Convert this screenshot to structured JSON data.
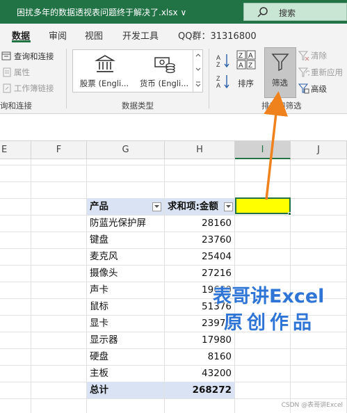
{
  "window": {
    "title": "困扰多年的数据透视表问题终于解决了.xlsx",
    "title_dropdown": "∨",
    "search_label": "搜索"
  },
  "menu": {
    "tabs": [
      "数据",
      "审阅",
      "视图",
      "开发工具",
      "QQ群：31316800"
    ],
    "active_tab": "数据"
  },
  "ribbon": {
    "get_data_group": {
      "items": [
        "查询和连接",
        "属性",
        "工作簿链接"
      ],
      "label": "询和连接"
    },
    "data_types_group": {
      "stocks_label": "股票 (Engli...",
      "currency_label": "货币 (Engli...",
      "label": "数据类型"
    },
    "sort_filter_group": {
      "sort_label": "排序",
      "filter_label": "筛选",
      "clear_label": "清除",
      "reapply_label": "重新应用",
      "advanced_label": "高级",
      "label": "排序和筛选"
    }
  },
  "sheet": {
    "columns": [
      "E",
      "F",
      "G",
      "H",
      "I",
      "J"
    ],
    "selected_column": "I",
    "pivot": {
      "header_product": "产品",
      "header_sum": "求和项:金额",
      "rows": [
        {
          "product": "防蓝光保护屏",
          "amount": "28160"
        },
        {
          "product": "键盘",
          "amount": "23760"
        },
        {
          "product": "麦克风",
          "amount": "25404"
        },
        {
          "product": "摄像头",
          "amount": "27216"
        },
        {
          "product": "声卡",
          "amount": "19680"
        },
        {
          "product": "鼠标",
          "amount": "51376"
        },
        {
          "product": "显卡",
          "amount": "23976"
        },
        {
          "product": "显示器",
          "amount": "17980"
        },
        {
          "product": "硬盘",
          "amount": "8160"
        },
        {
          "product": "主板",
          "amount": "43200"
        }
      ],
      "total_label": "总计",
      "total_value": "268272"
    },
    "selected_cell_fill": "#ffff00"
  },
  "watermark": {
    "line1": "表哥讲Excel",
    "line2": "原创作品",
    "credit": "CSDN @表哥讲Excel"
  },
  "colors": {
    "excel_green": "#217346",
    "arrow": "#f0821e",
    "watermark_blue": "#2e75d6",
    "pivot_header_fill": "#dae3f3"
  }
}
